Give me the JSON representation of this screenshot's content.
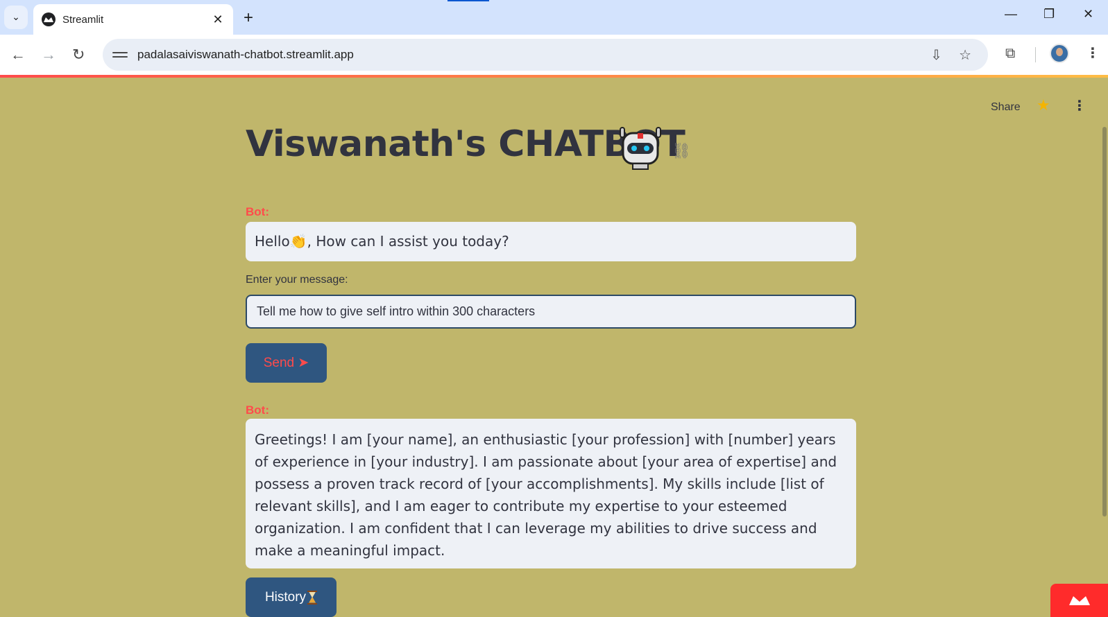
{
  "browser": {
    "tab_title": "Streamlit",
    "url": "padalasaiviswanath-chatbot.streamlit.app"
  },
  "header": {
    "share_label": "Share"
  },
  "page": {
    "title": "Viswanath's CHATBOT",
    "bot_label_1": "Bot:",
    "greeting_before": "Hello",
    "greeting_after": ", How can I assist you today?",
    "input_label": "Enter your message:",
    "input_value": "Tell me how to give self intro within 300 characters",
    "send_label": "Send ➤",
    "bot_label_2": "Bot:",
    "response": "Greetings! I am [your name], an enthusiastic [your profession] with [number] years of experience in [your industry]. I am passionate about [your area of expertise] and possess a proven track record of [your accomplishments]. My skills include [list of relevant skills], and I am eager to contribute my expertise to your esteemed organization. I am confident that I can leverage my abilities to drive success and make a meaningful impact.",
    "history_label": "History"
  },
  "colors": {
    "app_background": "#c0b66b",
    "button_background": "#2f5680",
    "accent_red": "#ff4b4b"
  },
  "icons": [
    "tab-list-icon",
    "streamlit-favicon",
    "close-icon",
    "plus-icon",
    "minimize-icon",
    "restore-icon",
    "window-close-icon",
    "back-icon",
    "forward-icon",
    "reload-icon",
    "site-info-icon",
    "install-icon",
    "bookmark-star-icon",
    "extensions-icon",
    "profile-avatar",
    "kebab-menu-icon",
    "favorite-star-icon",
    "robot-emoji-icon",
    "link-icon",
    "waving-hand-icon",
    "hourglass-icon",
    "streamlit-logo-icon"
  ]
}
